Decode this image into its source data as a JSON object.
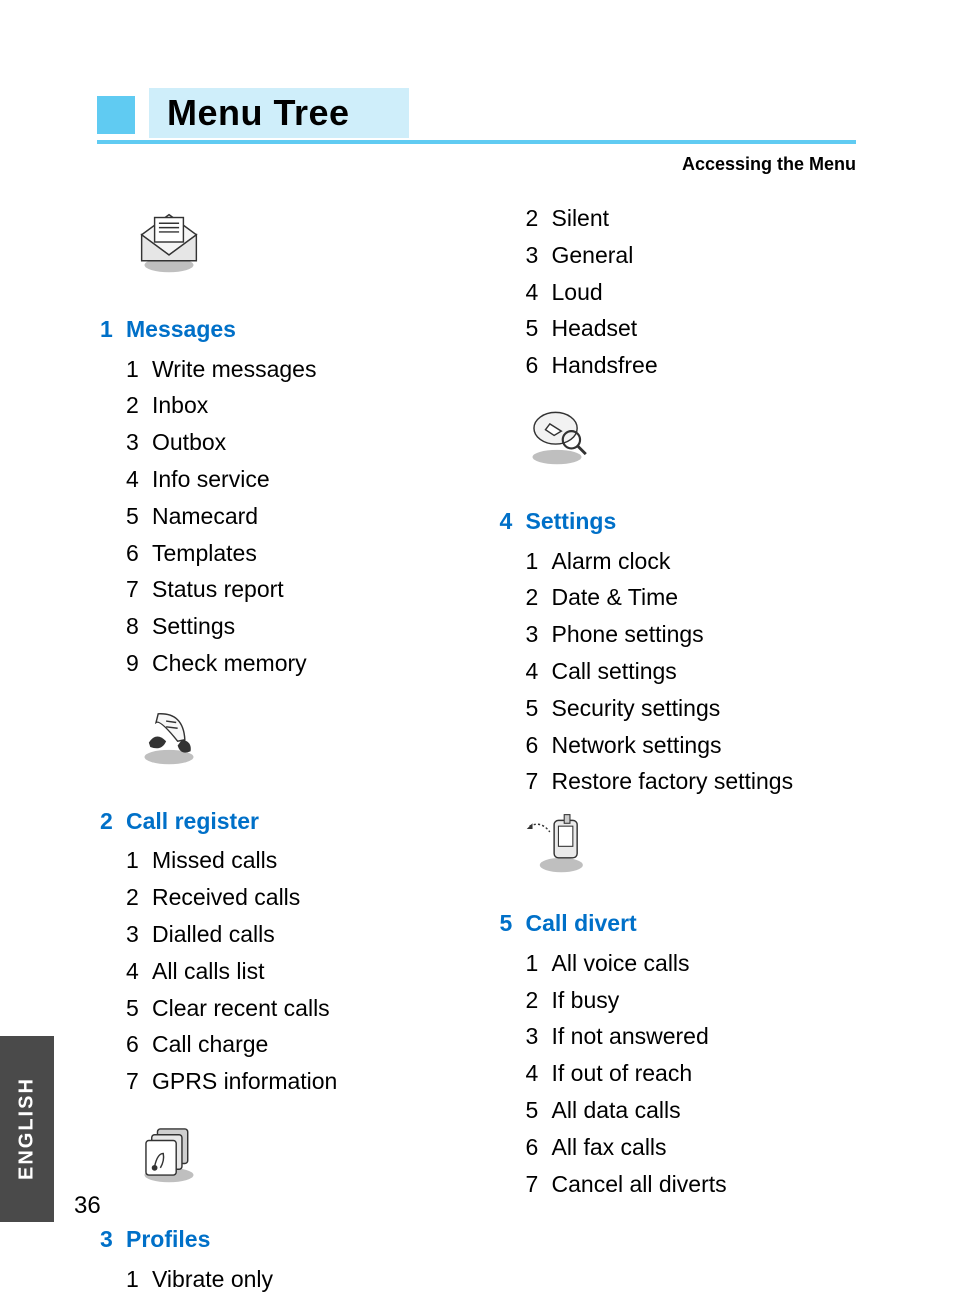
{
  "header": {
    "title": "Menu Tree",
    "subtitle": "Accessing the Menu"
  },
  "footer": {
    "language": "ENGLISH",
    "page": "36"
  },
  "menu": [
    {
      "num": "1",
      "title": "Messages",
      "icon": "envelope-icon",
      "items": [
        "Write messages",
        "Inbox",
        "Outbox",
        "Info service",
        "Namecard",
        "Templates",
        "Status report",
        "Settings",
        "Check memory"
      ]
    },
    {
      "num": "2",
      "title": "Call register",
      "icon": "call-log-icon",
      "items": [
        "Missed calls",
        "Received calls",
        "Dialled calls",
        "All calls list",
        "Clear recent calls",
        "Call charge",
        "GPRS information"
      ]
    },
    {
      "num": "3",
      "title": "Profiles",
      "icon": "profiles-icon",
      "items": [
        "Vibrate only",
        "Silent",
        "General",
        "Loud",
        "Headset",
        "Handsfree"
      ]
    },
    {
      "num": "4",
      "title": "Settings",
      "icon": "settings-icon",
      "items": [
        "Alarm clock",
        "Date & Time",
        "Phone settings",
        "Call settings",
        "Security settings",
        "Network settings",
        "Restore factory settings"
      ]
    },
    {
      "num": "5",
      "title": "Call divert",
      "icon": "divert-icon",
      "items": [
        "All voice calls",
        "If busy",
        "If not answered",
        "If out of reach",
        "All data calls",
        "All fax calls",
        "Cancel all diverts"
      ]
    }
  ]
}
